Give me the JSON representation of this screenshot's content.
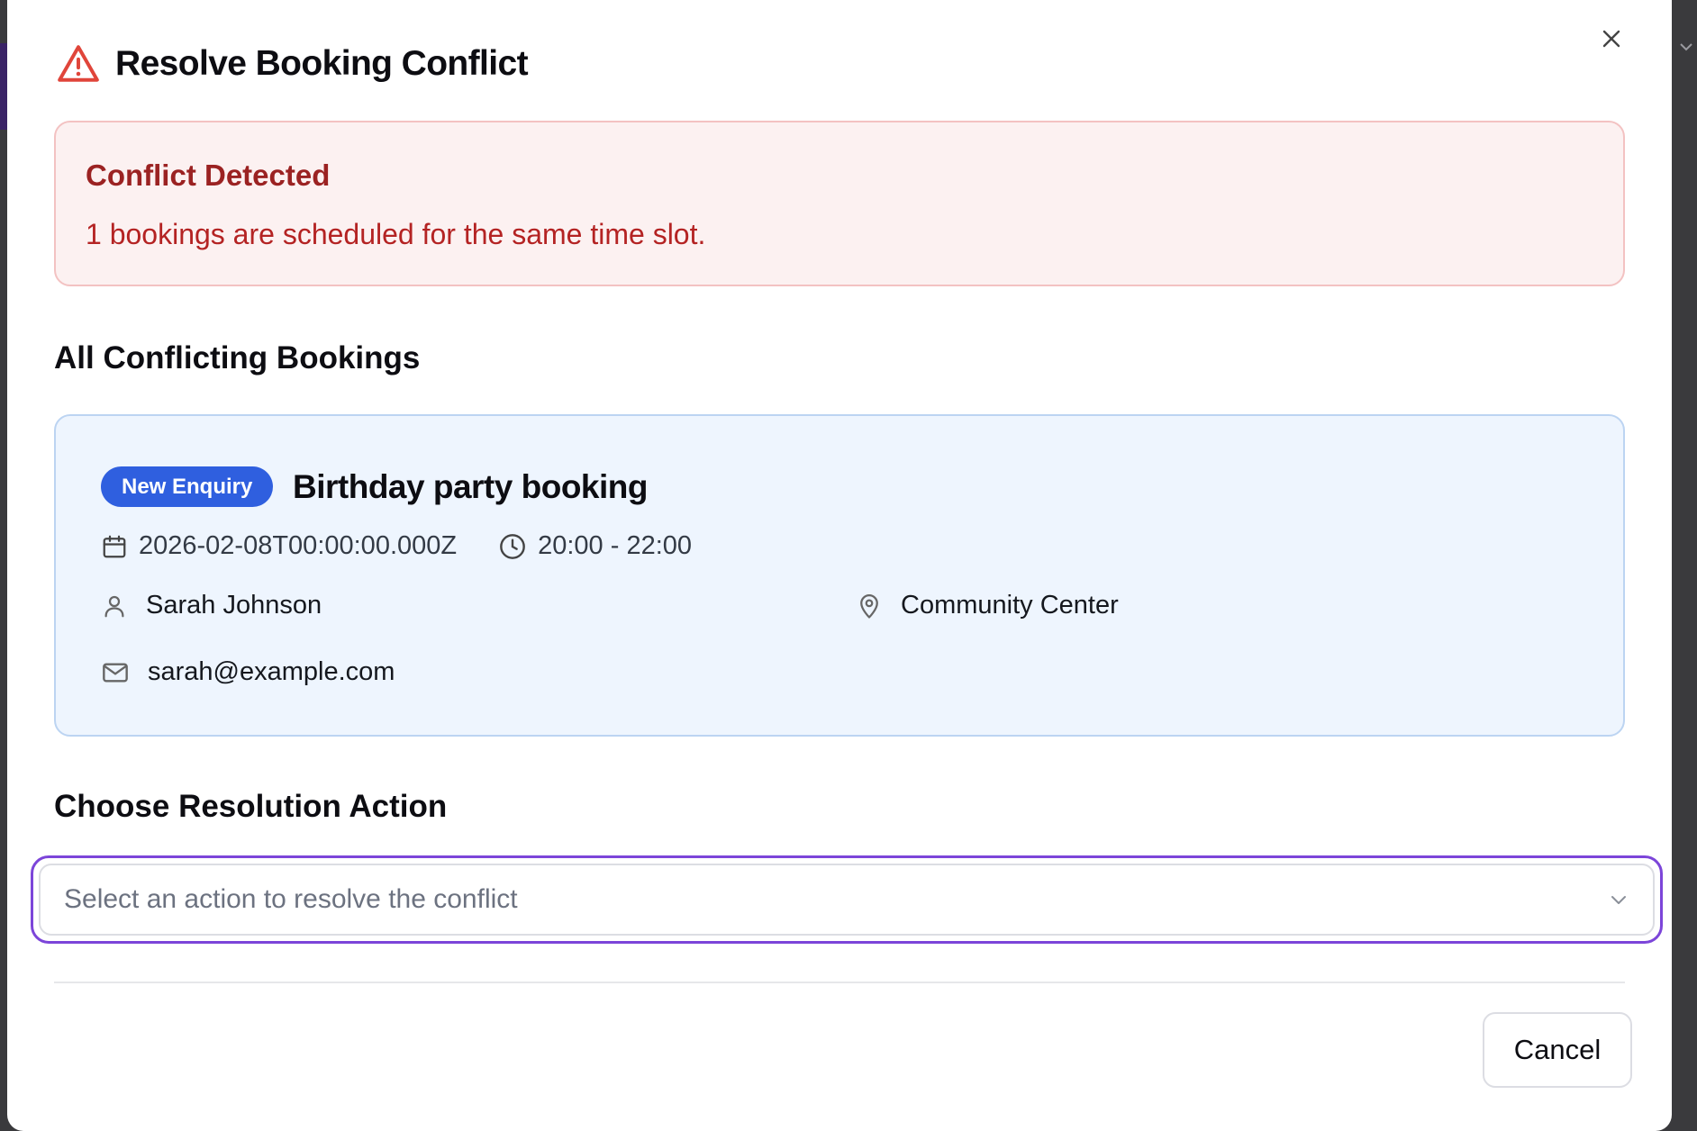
{
  "dialog": {
    "title": "Resolve Booking Conflict",
    "close_icon": "close-icon",
    "warning_icon": "alert-triangle-icon"
  },
  "alert": {
    "title": "Conflict Detected",
    "message": "1 bookings are scheduled for the same time slot."
  },
  "conflicts": {
    "heading": "All Conflicting Bookings",
    "booking": {
      "status_badge": "New Enquiry",
      "title": "Birthday party booking",
      "date": "2026-02-08T00:00:00.000Z",
      "time": "20:00 - 22:00",
      "customer_name": "Sarah Johnson",
      "location": "Community Center",
      "email": "sarah@example.com"
    }
  },
  "resolution": {
    "heading": "Choose Resolution Action",
    "placeholder": "Select an action to resolve the conflict"
  },
  "footer": {
    "cancel_label": "Cancel"
  },
  "colors": {
    "alert_background": "#fcf1f1",
    "alert_text": "#b42323",
    "badge_blue": "#2f5fdf",
    "card_background": "#eef5fe",
    "focus_ring": "#7c45d9"
  }
}
